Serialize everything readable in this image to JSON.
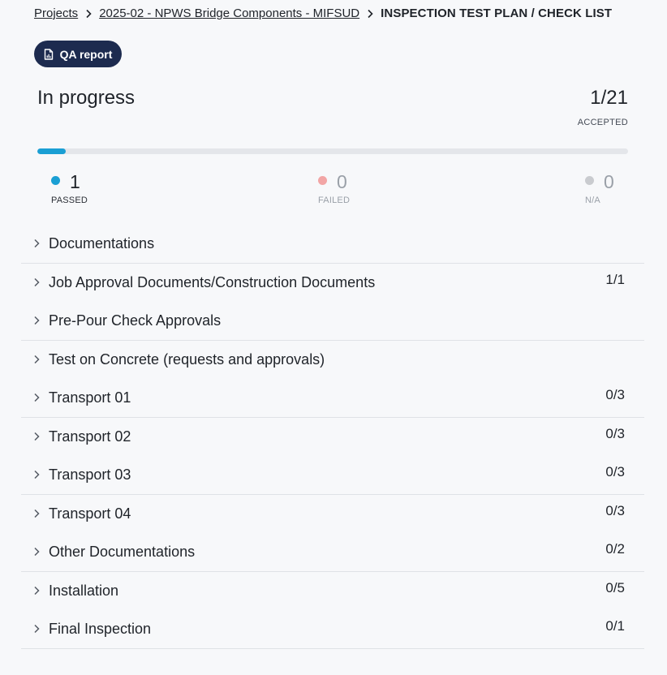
{
  "breadcrumb": {
    "projects": "Projects",
    "project": "2025-02 - NPWS Bridge Components - MIFSUD",
    "current": "INSPECTION TEST PLAN / CHECK LIST"
  },
  "qa_button": {
    "label": "QA report",
    "icon": "report-file-icon"
  },
  "summary": {
    "status": "In progress",
    "accepted_count": "1/21",
    "accepted_label": "ACCEPTED",
    "progress_fraction": 0.048,
    "passed": {
      "value": "1",
      "label": "PASSED"
    },
    "failed": {
      "value": "0",
      "label": "FAILED"
    },
    "na": {
      "value": "0",
      "label": "N/A"
    }
  },
  "colors": {
    "accent": "#1a9fd4",
    "button_bg": "#1d2b4f",
    "failed": "#f2a5a5",
    "na": "#c9cbcf"
  },
  "sections": [
    {
      "title": "Documentations",
      "count": ""
    },
    {
      "title": "Job Approval Documents/Construction Documents",
      "count": "1/1"
    },
    {
      "title": "Pre-Pour Check Approvals",
      "count": ""
    },
    {
      "title": "Test on Concrete (requests and approvals)",
      "count": ""
    },
    {
      "title": "Transport 01",
      "count": "0/3"
    },
    {
      "title": "Transport 02",
      "count": "0/3"
    },
    {
      "title": "Transport 03",
      "count": "0/3"
    },
    {
      "title": "Transport 04",
      "count": "0/3"
    },
    {
      "title": "Other Documentations",
      "count": "0/2"
    },
    {
      "title": "Installation",
      "count": "0/5"
    },
    {
      "title": "Final Inspection",
      "count": "0/1"
    }
  ]
}
